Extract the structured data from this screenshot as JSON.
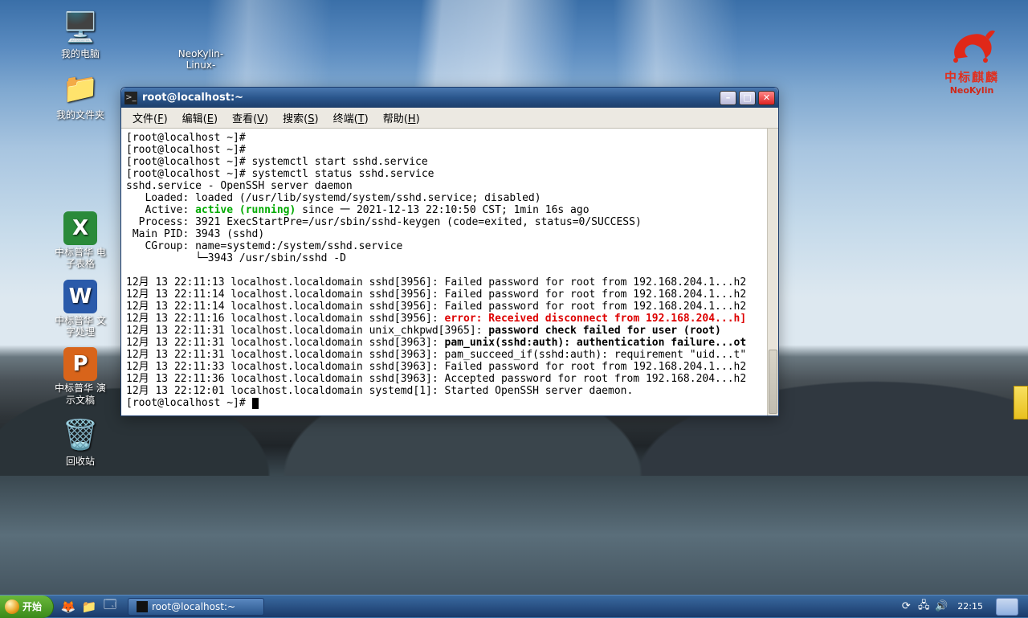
{
  "brand": {
    "cn": "中标麒麟",
    "en": "NeoKylin"
  },
  "desktop": {
    "computer": "我的电脑",
    "folder": "我的文件夹",
    "dvd": "NeoKylin-\nLinux-",
    "spreadsheet": "中标普华 电\n子表格",
    "writer": "中标普华 文\n字处理",
    "presentation": "中标普华 演\n示文稿",
    "trash": "回收站"
  },
  "window": {
    "title": "root@localhost:~",
    "menus": {
      "file": "文件",
      "file_k": "F",
      "edit": "编辑",
      "edit_k": "E",
      "view": "查看",
      "view_k": "V",
      "search": "搜索",
      "search_k": "S",
      "terminal": "终端",
      "terminal_k": "T",
      "help": "帮助",
      "help_k": "H"
    }
  },
  "term": {
    "p1": "[root@localhost ~]#",
    "p2": "[root@localhost ~]#",
    "p3": "[root@localhost ~]# systemctl start sshd.service",
    "p4": "[root@localhost ~]# systemctl status sshd.service",
    "s1": "sshd.service - OpenSSH server daemon",
    "s2": "   Loaded: loaded (/usr/lib/systemd/system/sshd.service; disabled)",
    "s3a": "   Active: ",
    "s3b": "active (running)",
    "s3c": " since 一 2021-12-13 22:10:50 CST; 1min 16s ago",
    "s4": "  Process: 3921 ExecStartPre=/usr/sbin/sshd-keygen (code=exited, status=0/SUCCESS)",
    "s5": " Main PID: 3943 (sshd)",
    "s6": "   CGroup: name=systemd:/system/sshd.service",
    "s7": "           └─3943 /usr/sbin/sshd -D",
    "blank": "",
    "l1": "12月 13 22:11:13 localhost.localdomain sshd[3956]: Failed password for root from 192.168.204.1...h2",
    "l2": "12月 13 22:11:14 localhost.localdomain sshd[3956]: Failed password for root from 192.168.204.1...h2",
    "l3": "12月 13 22:11:14 localhost.localdomain sshd[3956]: Failed password for root from 192.168.204.1...h2",
    "l4p": "12月 13 22:11:16 localhost.localdomain sshd[3956]: ",
    "l4e": "error: Received disconnect from 192.168.204...h]",
    "l5p": "12月 13 22:11:31 localhost.localdomain unix_chkpwd[3965]: ",
    "l5b": "password check failed for user (root)",
    "l6p": "12月 13 22:11:31 localhost.localdomain sshd[3963]: ",
    "l6b": "pam_unix(sshd:auth): authentication failure...ot",
    "l7": "12月 13 22:11:31 localhost.localdomain sshd[3963]: pam_succeed_if(sshd:auth): requirement \"uid...t\"",
    "l8": "12月 13 22:11:33 localhost.localdomain sshd[3963]: Failed password for root from 192.168.204.1...h2",
    "l9": "12月 13 22:11:36 localhost.localdomain sshd[3963]: Accepted password for root from 192.168.204...h2",
    "l10": "12月 13 22:12:01 localhost.localdomain systemd[1]: Started OpenSSH server daemon.",
    "pend": "[root@localhost ~]# "
  },
  "taskbar": {
    "start": "开始",
    "task1": "root@localhost:~",
    "clock": "22:15"
  }
}
